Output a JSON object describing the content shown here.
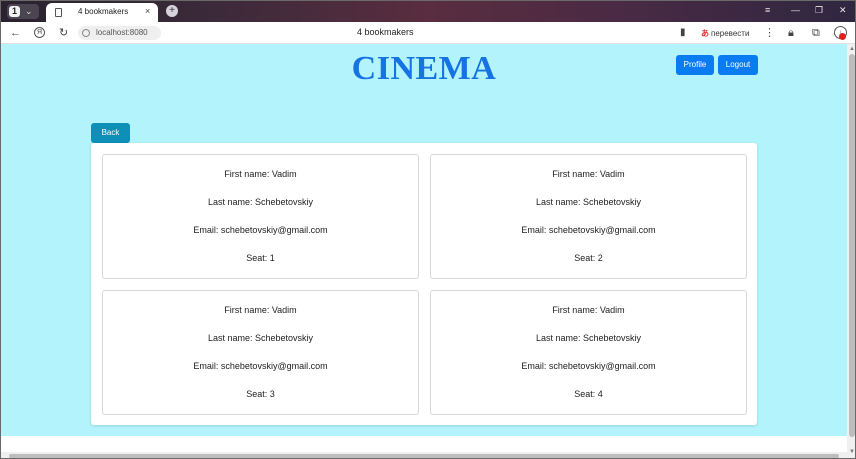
{
  "browser": {
    "tab_count": "1",
    "tab_title": "4 bookmakers",
    "tab_close": "×",
    "new_tab": "+",
    "url": "localhost:8080",
    "page_title": "4 bookmakers",
    "translate_label": "перевести",
    "window_controls": [
      "≡",
      "—",
      "❐",
      "✕"
    ],
    "nav_icons": [
      "back-arrow-icon",
      "yandex-icon",
      "reload-icon"
    ]
  },
  "header": {
    "brand": "CINEMA",
    "profile_label": "Profile",
    "logout_label": "Logout"
  },
  "back_label": "Back",
  "bookings": [
    {
      "first_name": "First name: Vadim",
      "last_name": "Last name: Schebetovskiy",
      "email": "Email: schebetovskiy@gmail.com",
      "seat": "Seat: 1"
    },
    {
      "first_name": "First name: Vadim",
      "last_name": "Last name: Schebetovskiy",
      "email": "Email: schebetovskiy@gmail.com",
      "seat": "Seat: 2"
    },
    {
      "first_name": "First name: Vadim",
      "last_name": "Last name: Schebetovskiy",
      "email": "Email: schebetovskiy@gmail.com",
      "seat": "Seat: 3"
    },
    {
      "first_name": "First name: Vadim",
      "last_name": "Last name: Schebetovskiy",
      "email": "Email: schebetovskiy@gmail.com",
      "seat": "Seat: 4"
    }
  ],
  "colors": {
    "page_background": "#b3f3fb",
    "brand": "#1573e3",
    "primary_button": "#0b7bf1",
    "back_button": "#0d8fb7"
  }
}
